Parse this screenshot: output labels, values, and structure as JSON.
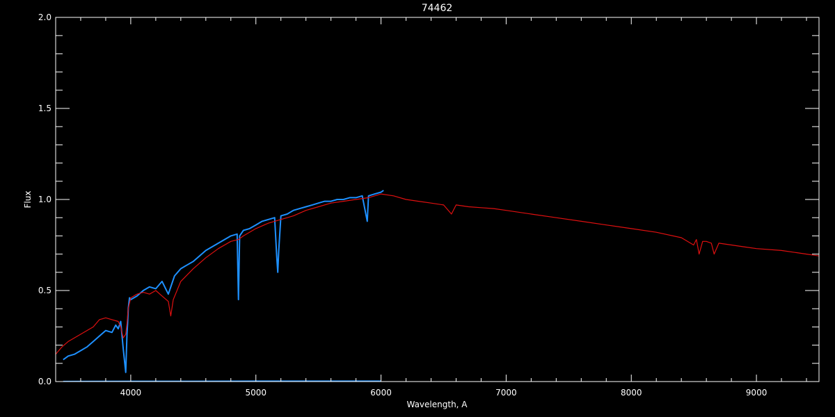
{
  "chart_data": {
    "type": "line",
    "title": "74462",
    "xlabel": "Wavelength, A",
    "ylabel": "Flux",
    "xlim": [
      3400,
      9500
    ],
    "ylim": [
      0.0,
      2.0
    ],
    "x_ticks": [
      4000,
      5000,
      6000,
      7000,
      8000,
      9000
    ],
    "x_tick_labels": [
      "4000",
      "5000",
      "6000",
      "7000",
      "8000",
      "9000"
    ],
    "y_ticks": [
      0.0,
      0.5,
      1.0,
      1.5,
      2.0
    ],
    "y_tick_labels": [
      "0.0",
      "0.5",
      "1.0",
      "1.5",
      "2.0"
    ],
    "grid": false,
    "background": "#000000",
    "axis_color": "#ffffff",
    "series": [
      {
        "color": "#1e90ff",
        "x": [
          3460,
          3500,
          3550,
          3600,
          3650,
          3700,
          3750,
          3800,
          3850,
          3880,
          3900,
          3920,
          3940,
          3960,
          3970,
          3975,
          3980,
          3990,
          4000,
          4050,
          4100,
          4150,
          4200,
          4250,
          4300,
          4350,
          4400,
          4450,
          4500,
          4550,
          4600,
          4650,
          4700,
          4750,
          4800,
          4850,
          4861,
          4870,
          4900,
          4950,
          5000,
          5050,
          5100,
          5150,
          5167,
          5175,
          5183,
          5200,
          5250,
          5300,
          5350,
          5400,
          5450,
          5500,
          5550,
          5600,
          5650,
          5700,
          5750,
          5800,
          5850,
          5890,
          5900,
          5950,
          6000,
          6020
        ],
        "y": [
          0.12,
          0.14,
          0.15,
          0.17,
          0.19,
          0.22,
          0.25,
          0.28,
          0.27,
          0.31,
          0.29,
          0.33,
          0.18,
          0.05,
          0.26,
          0.32,
          0.4,
          0.46,
          0.45,
          0.47,
          0.5,
          0.52,
          0.51,
          0.55,
          0.48,
          0.58,
          0.62,
          0.64,
          0.66,
          0.69,
          0.72,
          0.74,
          0.76,
          0.78,
          0.8,
          0.81,
          0.45,
          0.8,
          0.83,
          0.84,
          0.86,
          0.88,
          0.89,
          0.9,
          0.68,
          0.6,
          0.72,
          0.91,
          0.92,
          0.94,
          0.95,
          0.96,
          0.97,
          0.98,
          0.99,
          0.99,
          1.0,
          1.0,
          1.01,
          1.01,
          1.02,
          0.88,
          1.02,
          1.03,
          1.04,
          1.05
        ]
      },
      {
        "color": "#e01010",
        "x": [
          3400,
          3450,
          3500,
          3550,
          3600,
          3650,
          3700,
          3750,
          3800,
          3850,
          3900,
          3920,
          3940,
          3960,
          3970,
          3980,
          4000,
          4050,
          4100,
          4150,
          4200,
          4250,
          4300,
          4320,
          4340,
          4400,
          4500,
          4600,
          4700,
          4800,
          4861,
          4900,
          5000,
          5100,
          5200,
          5300,
          5400,
          5500,
          5600,
          5700,
          5800,
          5900,
          6000,
          6100,
          6200,
          6300,
          6400,
          6500,
          6563,
          6600,
          6700,
          6800,
          6900,
          7000,
          7200,
          7400,
          7600,
          7800,
          8000,
          8200,
          8400,
          8498,
          8520,
          8542,
          8570,
          8600,
          8640,
          8662,
          8700,
          8800,
          8900,
          9000,
          9200,
          9400,
          9500
        ],
        "y": [
          0.15,
          0.19,
          0.22,
          0.24,
          0.26,
          0.28,
          0.3,
          0.34,
          0.35,
          0.34,
          0.33,
          0.3,
          0.24,
          0.26,
          0.32,
          0.4,
          0.46,
          0.48,
          0.49,
          0.48,
          0.5,
          0.47,
          0.44,
          0.36,
          0.45,
          0.55,
          0.62,
          0.68,
          0.73,
          0.77,
          0.78,
          0.8,
          0.84,
          0.87,
          0.89,
          0.91,
          0.94,
          0.96,
          0.98,
          0.99,
          1.0,
          1.01,
          1.03,
          1.02,
          1.0,
          0.99,
          0.98,
          0.97,
          0.92,
          0.97,
          0.96,
          0.955,
          0.95,
          0.94,
          0.92,
          0.9,
          0.88,
          0.86,
          0.84,
          0.82,
          0.79,
          0.75,
          0.78,
          0.7,
          0.77,
          0.77,
          0.76,
          0.7,
          0.76,
          0.75,
          0.74,
          0.73,
          0.72,
          0.7,
          0.69
        ]
      },
      {
        "color": "#1e90ff",
        "x": [
          3460,
          4000,
          4500,
          5000,
          5500,
          6000
        ],
        "y": [
          0.002,
          0.003,
          0.003,
          0.004,
          0.004,
          0.004
        ]
      }
    ]
  }
}
